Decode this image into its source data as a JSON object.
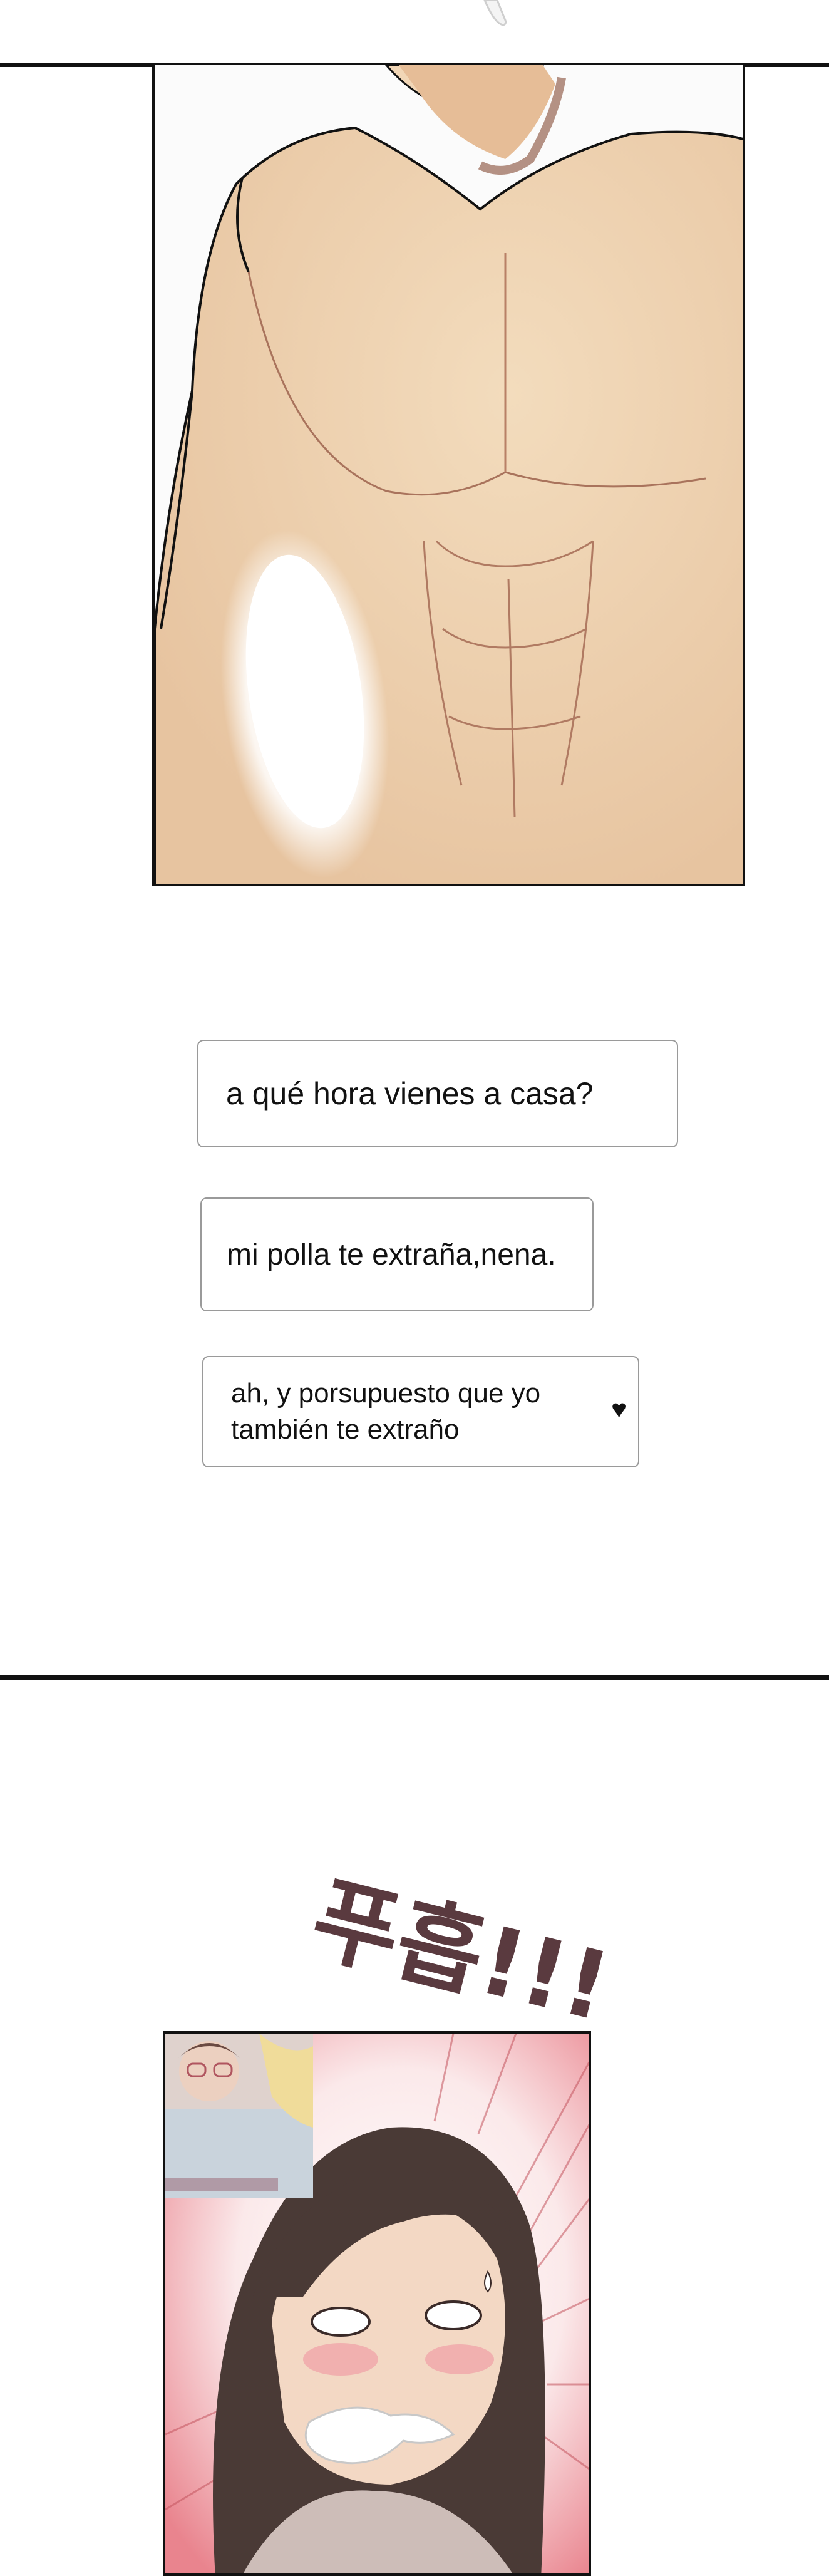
{
  "chat": {
    "messages": [
      {
        "text": "a qué hora vienes a casa?"
      },
      {
        "text": "mi polla te extraña,nena."
      },
      {
        "text": "ah, y porsupuesto que yo también te extraño",
        "icon": "heart-icon"
      }
    ]
  },
  "sfx": {
    "text": "푸흡!!!"
  },
  "colors": {
    "skin": "#efd3b0",
    "skin_shadow": "#e2b99a",
    "outline": "#111111",
    "blush": "#f0a0a6",
    "hair": "#4a3a36"
  }
}
